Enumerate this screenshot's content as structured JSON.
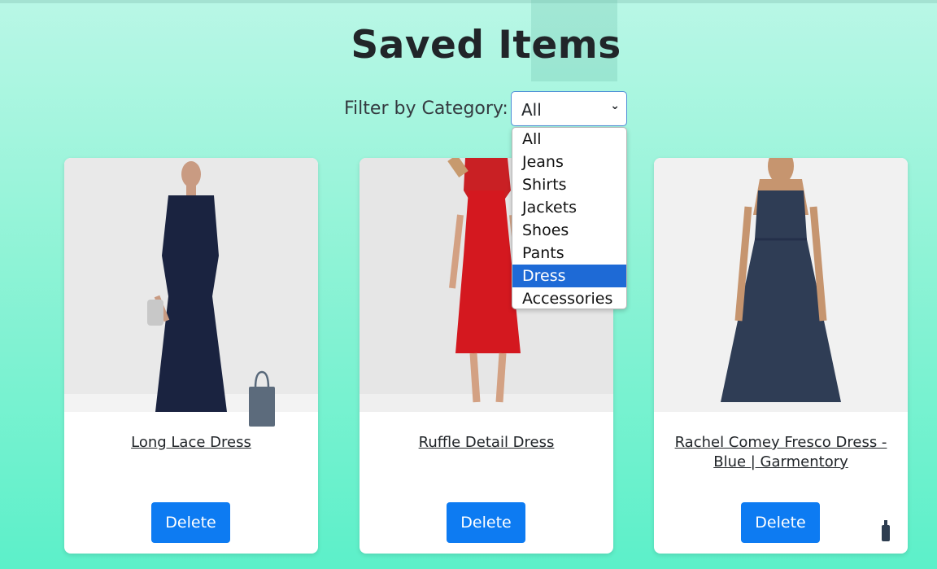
{
  "page": {
    "title": "Saved Items"
  },
  "filter": {
    "label": "Filter by Category:",
    "selected": "All",
    "options": [
      "All",
      "Jeans",
      "Shirts",
      "Jackets",
      "Shoes",
      "Pants",
      "Dress",
      "Accessories"
    ],
    "highlighted": "Dress"
  },
  "cards": [
    {
      "name": "Long Lace Dress",
      "delete_label": "Delete",
      "dress_color": "#1a2340"
    },
    {
      "name": "Ruffle Detail Dress",
      "delete_label": "Delete",
      "dress_color": "#d4181f"
    },
    {
      "name": "Rachel Comey Fresco Dress - Blue | Garmentory",
      "delete_label": "Delete",
      "dress_color": "#2f3d55"
    }
  ],
  "colors": {
    "accent": "#0d7bf2",
    "highlight": "#1e6ad6"
  }
}
